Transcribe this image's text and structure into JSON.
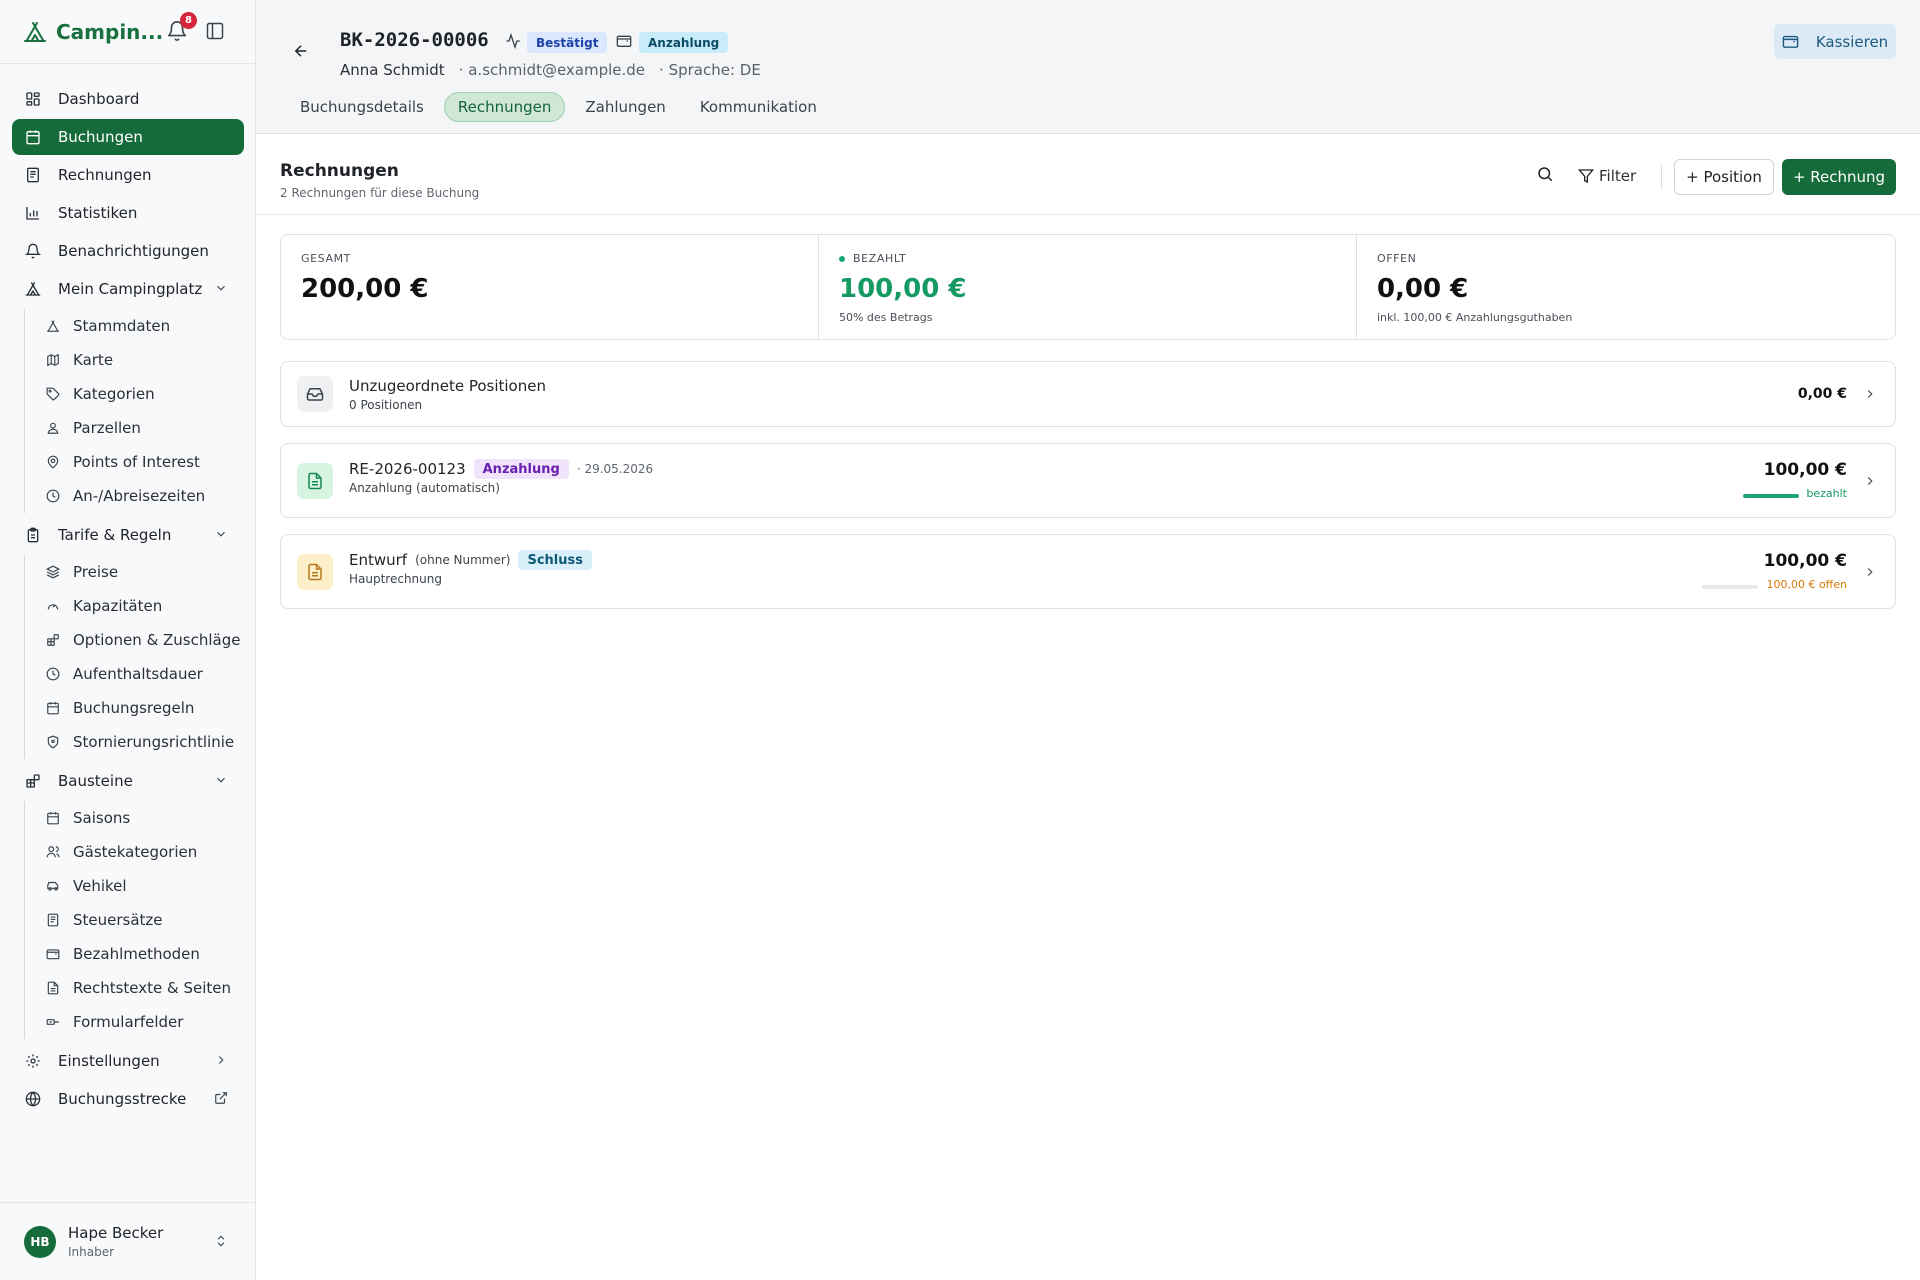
{
  "brand": {
    "name": "Campin...",
    "notifications": "8"
  },
  "nav": {
    "dashboard": "Dashboard",
    "buchungen": "Buchungen",
    "rechnungen": "Rechnungen",
    "statistiken": "Statistiken",
    "benachrichtigungen": "Benachrichtigungen",
    "mein_campingplatz": "Mein Campingplatz",
    "mein_sub": [
      "Stammdaten",
      "Karte",
      "Kategorien",
      "Parzellen",
      "Points of Interest",
      "An-/Abreisezeiten"
    ],
    "tarife": "Tarife & Regeln",
    "tarife_sub": [
      "Preise",
      "Kapazitäten",
      "Optionen & Zuschläge",
      "Aufenthaltsdauer",
      "Buchungsregeln",
      "Stornierungsrichtlinie"
    ],
    "bausteine": "Bausteine",
    "bausteine_sub": [
      "Saisons",
      "Gästekategorien",
      "Vehikel",
      "Steuersätze",
      "Bezahlmethoden",
      "Rechtstexte & Seiten",
      "Formularfelder"
    ],
    "einstellungen": "Einstellungen",
    "buchungsstrecke": "Buchungsstrecke"
  },
  "user": {
    "initials": "HB",
    "name": "Hape Becker",
    "role": "Inhaber"
  },
  "booking": {
    "id": "BK-2026-00006",
    "status": "Bestätigt",
    "payment_status": "Anzahlung",
    "customer": "Anna Schmidt",
    "email": "· a.schmidt@example.de",
    "language": "· Sprache: DE",
    "checkout_label": "Kassieren"
  },
  "tabs": [
    "Buchungsdetails",
    "Rechnungen",
    "Zahlungen",
    "Kommunikation"
  ],
  "section": {
    "title": "Rechnungen",
    "subtitle": "2 Rechnungen für diese Buchung",
    "filter_label": "Filter",
    "add_position_label": "+ Position",
    "add_invoice_label": "+ Rechnung"
  },
  "summary": {
    "total": {
      "label": "GESAMT",
      "value": "200,00 €"
    },
    "paid": {
      "label": "BEZAHLT",
      "value": "100,00 €",
      "note": "50% des Betrags"
    },
    "open": {
      "label": "OFFEN",
      "value": "0,00 €",
      "note": "inkl. 100,00 € Anzahlungsguthaben"
    }
  },
  "unassigned": {
    "title": "Unzugeordnete Positionen",
    "subtitle": "0 Positionen",
    "amount": "0,00 €"
  },
  "invoices": [
    {
      "number": "RE-2026-00123",
      "type": "Anzahlung",
      "date": "· 29.05.2026",
      "subtitle": "Anzahlung (automatisch)",
      "amount": "100,00 €",
      "status": "bezahlt",
      "progress": 1.0
    },
    {
      "number": "Entwurf",
      "number_note": "(ohne Nummer)",
      "type": "Schluss",
      "subtitle": "Hauptrechnung",
      "amount": "100,00 €",
      "status": "100,00 € offen",
      "progress": 0.0
    }
  ],
  "colors": {
    "brand": "#156b39",
    "paid": "#169a62",
    "open": "#d97706",
    "badge_notify": "#d6263b"
  }
}
